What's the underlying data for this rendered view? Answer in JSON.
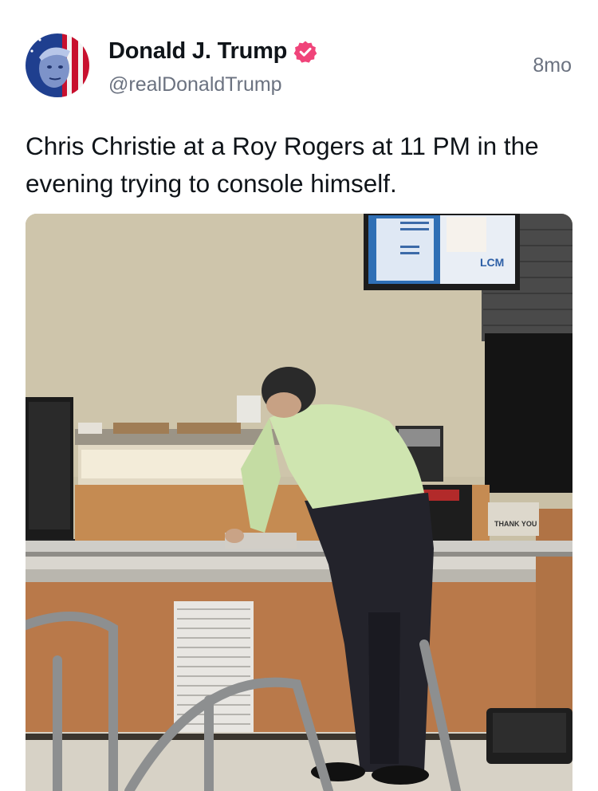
{
  "author": {
    "display_name": "Donald J. Trump",
    "handle": "@realDonaldTrump",
    "verified": true,
    "avatar_icon": "flag-portrait-avatar",
    "verified_icon": "verified-badge-icon",
    "verified_color": "#f0447a"
  },
  "post": {
    "timestamp": "8mo",
    "text": "Chris Christie at a Roy Rogers at 11 PM in the evening trying to console himself."
  },
  "media": {
    "type": "photo",
    "tv_logo_text": "LCM",
    "counter_sign_text": "THANK YOU"
  }
}
